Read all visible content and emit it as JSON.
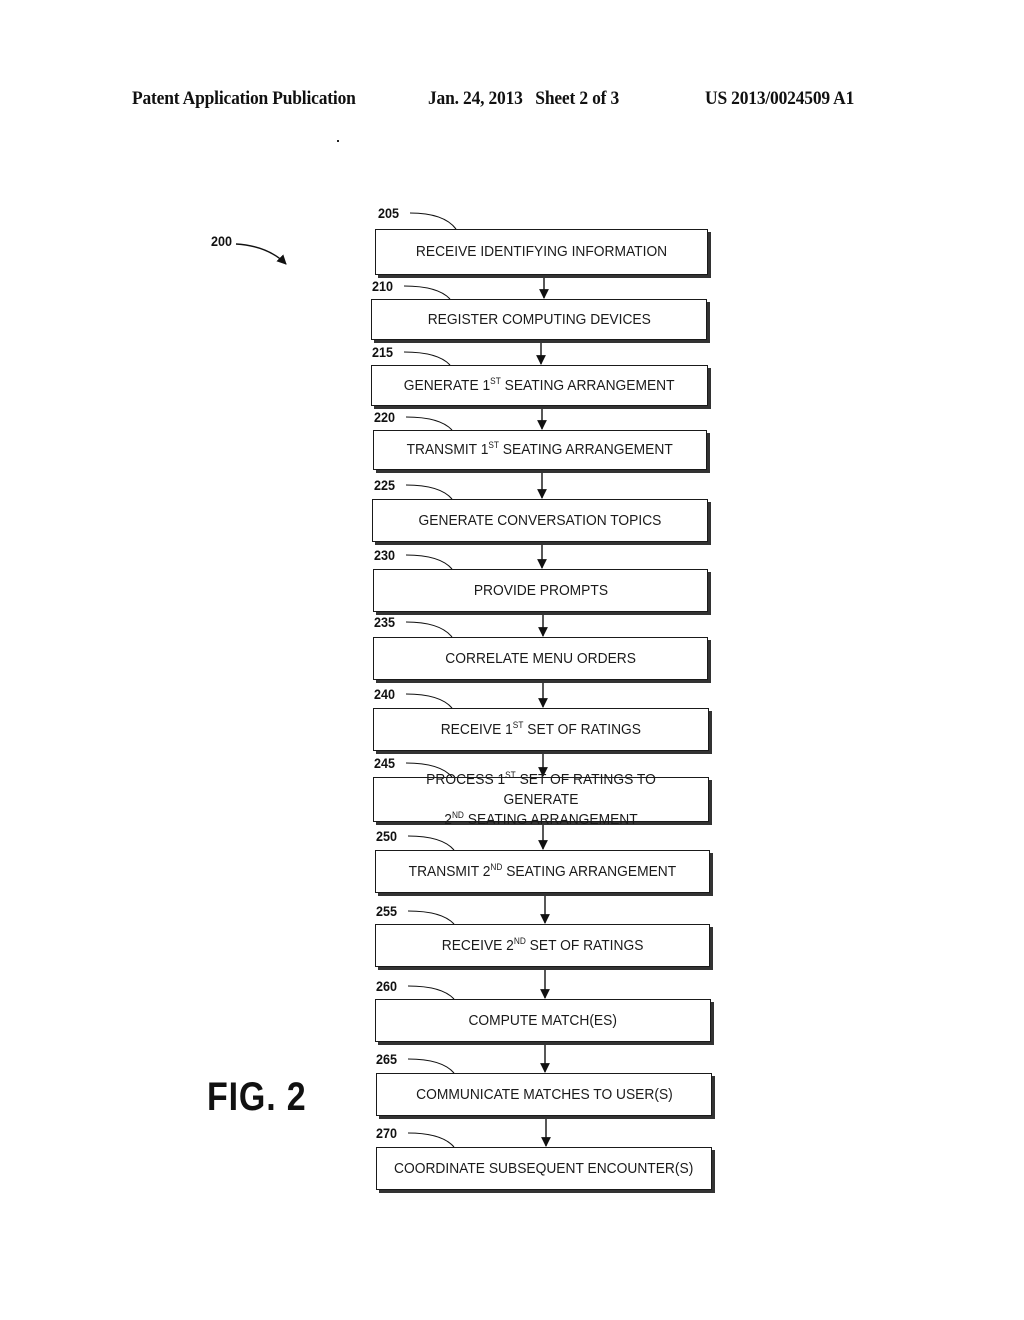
{
  "header": {
    "left": "Patent Application Publication",
    "middle": "Jan. 24, 2013   Sheet 2 of 3",
    "right": "US 2013/0024509 A1"
  },
  "figure": {
    "label": "FIG. 2",
    "ref": "200"
  },
  "steps": [
    {
      "ref": "205",
      "parts": [
        [
          "RECEIVE IDENTIFYING INFORMATION",
          ""
        ]
      ]
    },
    {
      "ref": "210",
      "parts": [
        [
          "REGISTER COMPUTING DEVICES",
          ""
        ]
      ]
    },
    {
      "ref": "215",
      "parts": [
        [
          "GENERATE 1",
          "ST"
        ],
        [
          " SEATING ARRANGEMENT",
          ""
        ]
      ]
    },
    {
      "ref": "220",
      "parts": [
        [
          "TRANSMIT 1",
          "ST"
        ],
        [
          " SEATING ARRANGEMENT",
          ""
        ]
      ]
    },
    {
      "ref": "225",
      "parts": [
        [
          "GENERATE CONVERSATION TOPICS",
          ""
        ]
      ]
    },
    {
      "ref": "230",
      "parts": [
        [
          "PROVIDE PROMPTS",
          ""
        ]
      ]
    },
    {
      "ref": "235",
      "parts": [
        [
          "CORRELATE MENU ORDERS",
          ""
        ]
      ]
    },
    {
      "ref": "240",
      "parts": [
        [
          "RECEIVE 1",
          "ST"
        ],
        [
          " SET OF RATINGS",
          ""
        ]
      ]
    },
    {
      "ref": "245",
      "parts": [
        [
          "PROCESS 1",
          "ST"
        ],
        [
          " SET OF RATINGS TO GENERATE\n2",
          "ND"
        ],
        [
          " SEATING ARRANGEMENT",
          ""
        ]
      ]
    },
    {
      "ref": "250",
      "parts": [
        [
          "TRANSMIT 2",
          "ND"
        ],
        [
          " SEATING ARRANGEMENT",
          ""
        ]
      ]
    },
    {
      "ref": "255",
      "parts": [
        [
          "RECEIVE 2",
          "ND"
        ],
        [
          " SET OF RATINGS",
          ""
        ]
      ]
    },
    {
      "ref": "260",
      "parts": [
        [
          "COMPUTE MATCH(ES)",
          ""
        ]
      ]
    },
    {
      "ref": "265",
      "parts": [
        [
          "COMMUNICATE MATCHES TO USER(S)",
          ""
        ]
      ]
    },
    {
      "ref": "270",
      "parts": [
        [
          "COORDINATE SUBSEQUENT ENCOUNTER(S)",
          ""
        ]
      ]
    }
  ]
}
